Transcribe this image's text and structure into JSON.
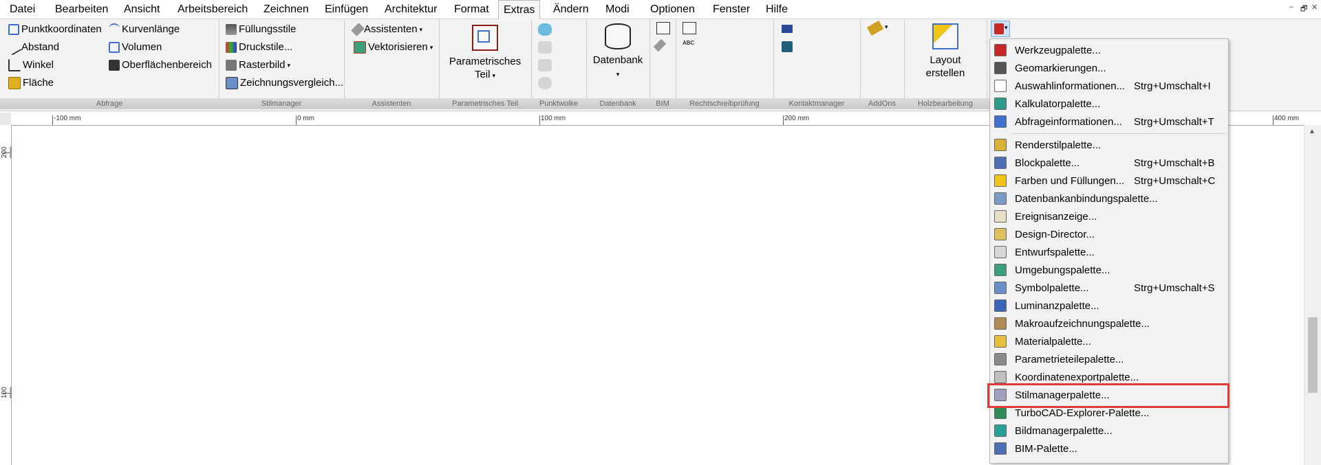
{
  "menu": [
    "Datei",
    "Bearbeiten",
    "Ansicht",
    "Arbeitsbereich",
    "Zeichnen",
    "Einfügen",
    "Architektur",
    "Format",
    "Extras",
    "Ändern",
    "Modi",
    "Optionen",
    "Fenster",
    "Hilfe"
  ],
  "window_controls": [
    "–",
    "🗗",
    "✕"
  ],
  "ribbon": {
    "abfrage": {
      "label": "Abfrage",
      "items": [
        "Punktkoordinaten",
        "Abstand",
        "Winkel",
        "Fläche",
        "Kurvenlänge",
        "Volumen",
        "Oberflächenbereich"
      ]
    },
    "stilmanager": {
      "label": "Stilmanager",
      "items": [
        "Füllungsstile",
        "Druckstile...",
        "Rasterbild",
        "Zeichnungsvergleich..."
      ]
    },
    "assistenten": {
      "label": "Assistenten",
      "items": [
        "Assistenten",
        "Vektorisieren"
      ]
    },
    "parametrisch": {
      "label": "Parametrisches Teil",
      "button": [
        "Parametrisches",
        "Teil"
      ]
    },
    "punktwolke": {
      "label": "Punktwolke"
    },
    "datenbank": {
      "label": "Datenbank",
      "button": "Datenbank"
    },
    "bim": {
      "label": "BIM"
    },
    "rechtschreib": {
      "label": "Rechtschreibprüfung"
    },
    "kontakt": {
      "label": "Kontaktmanager"
    },
    "addons": {
      "label": "AddOns"
    },
    "holz": {
      "label": "Holzbearbeitung",
      "button": [
        "Layout",
        "erstellen"
      ]
    }
  },
  "ruler": {
    "h_labels": [
      "-100 mm",
      "0 mm",
      "100 mm",
      "200 mm",
      "400 mm"
    ],
    "v_labels": [
      "200 mm",
      "100 mm"
    ]
  },
  "dropdown": {
    "items": [
      {
        "label": "Werkzeugpalette...",
        "shortcut": "",
        "color": "#c62828"
      },
      {
        "label": "Geomarkierungen...",
        "shortcut": "",
        "color": "#555555"
      },
      {
        "label": "Auswahlinformationen...",
        "shortcut": "Strg+Umschalt+I",
        "color": "#ffffff"
      },
      {
        "label": "Kalkulatorpalette...",
        "shortcut": "",
        "color": "#2e9b8a"
      },
      {
        "label": "Abfrageinformationen...",
        "shortcut": "Strg+Umschalt+T",
        "color": "#3f6fd1"
      },
      {
        "label": "Renderstilpalette...",
        "shortcut": "",
        "color": "#d9b23a"
      },
      {
        "label": "Blockpalette...",
        "shortcut": "Strg+Umschalt+B",
        "color": "#4a6fb5"
      },
      {
        "label": "Farben und Füllungen...",
        "shortcut": "Strg+Umschalt+C",
        "color": "#f0c419"
      },
      {
        "label": "Datenbankanbindungspalette...",
        "shortcut": "",
        "color": "#7a9cc6"
      },
      {
        "label": "Ereignisanzeige...",
        "shortcut": "",
        "color": "#e8e0c8"
      },
      {
        "label": "Design-Director...",
        "shortcut": "",
        "color": "#e0c060"
      },
      {
        "label": "Entwurfspalette...",
        "shortcut": "",
        "color": "#d8d8d8"
      },
      {
        "label": "Umgebungspalette...",
        "shortcut": "",
        "color": "#3aa07a"
      },
      {
        "label": "Symbolpalette...",
        "shortcut": "Strg+Umschalt+S",
        "color": "#6a8fc8"
      },
      {
        "label": "Luminanzpalette...",
        "shortcut": "",
        "color": "#3b66b8"
      },
      {
        "label": "Makroaufzeichnungspalette...",
        "shortcut": "",
        "color": "#b08a55"
      },
      {
        "label": "Materialpalette...",
        "shortcut": "",
        "color": "#e8c040"
      },
      {
        "label": "Parametrieteilepalette...",
        "shortcut": "",
        "color": "#8a8a8a"
      },
      {
        "label": "Koordinatenexportpalette...",
        "shortcut": "",
        "color": "#bfbfbf"
      },
      {
        "label": "Stilmanagerpalette...",
        "shortcut": "",
        "color": "#a0a0c0"
      },
      {
        "label": "TurboCAD-Explorer-Palette...",
        "shortcut": "",
        "color": "#2e8b57"
      },
      {
        "label": "Bildmanagerpalette...",
        "shortcut": "",
        "color": "#2aa198"
      },
      {
        "label": "BIM-Palette...",
        "shortcut": "",
        "color": "#4a6fb5"
      }
    ]
  }
}
